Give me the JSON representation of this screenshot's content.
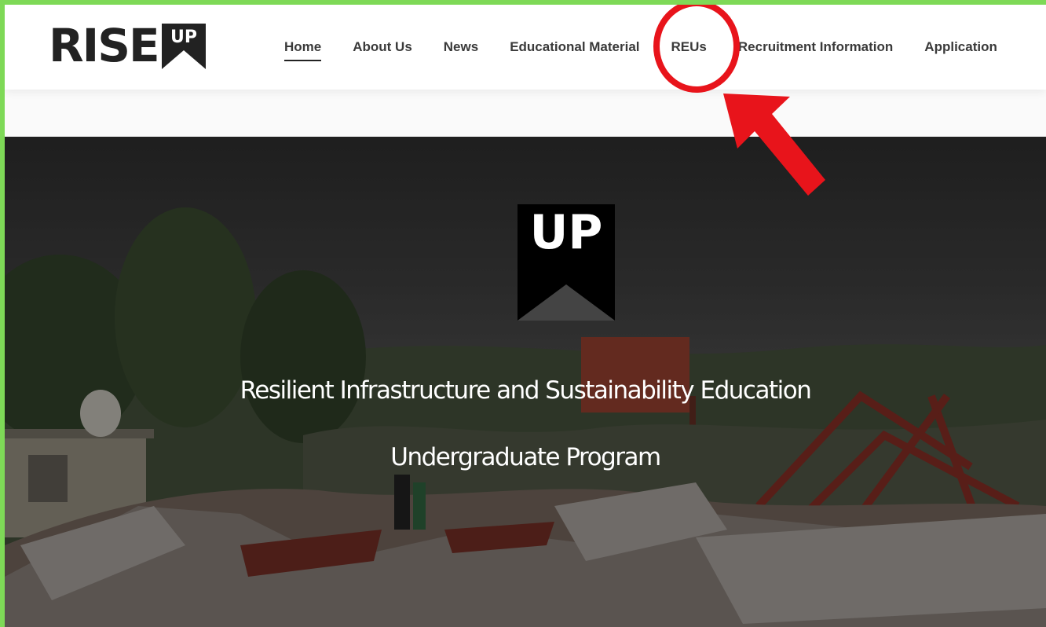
{
  "brand": {
    "logo_text": "RISE",
    "logo_mark_text": "UP"
  },
  "nav": {
    "items": [
      {
        "label": "Home",
        "active": true
      },
      {
        "label": "About Us",
        "active": false
      },
      {
        "label": "News",
        "active": false
      },
      {
        "label": "Educational Material",
        "active": false
      },
      {
        "label": "REUs",
        "active": false
      },
      {
        "label": "Recruitment Information",
        "active": false
      },
      {
        "label": "Application",
        "active": false
      }
    ]
  },
  "hero": {
    "emblem_text": "UP",
    "title_line1": "Resilient Infrastructure and Sustainability Education",
    "title_line2": "Undergraduate Program"
  },
  "annotation": {
    "color": "#e8141b",
    "target": "REUs"
  },
  "colors": {
    "border": "#7ed957",
    "nav_text": "#3a3a3a",
    "accent": "#e8141b"
  }
}
